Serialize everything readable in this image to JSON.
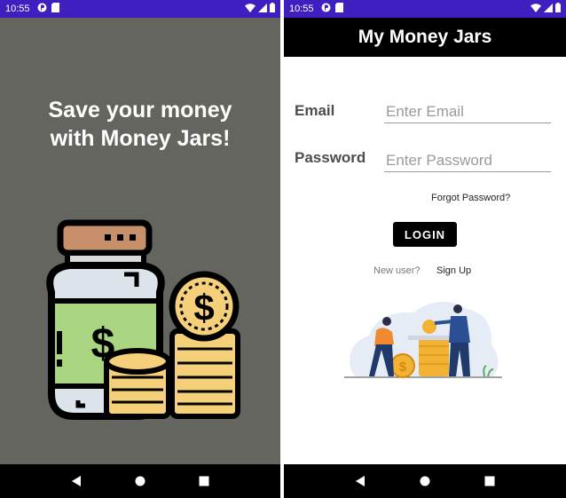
{
  "left_screen": {
    "status": {
      "time": "10:55"
    },
    "title_line1": "Save your money",
    "title_line2": "with Money Jars!",
    "illustration": "money-jar-and-coins",
    "nav": [
      "back",
      "home",
      "recents"
    ]
  },
  "right_screen": {
    "status": {
      "time": "10:55"
    },
    "header_title": "My Money Jars",
    "email_label": "Email",
    "email_placeholder": "Enter Email",
    "password_label": "Password",
    "password_placeholder": "Enter Password",
    "forgot_password": "Forgot Password?",
    "login_button": "LOGIN",
    "new_user_text": "New user?",
    "sign_up_link": "Sign Up",
    "illustration": "people-saving-coins",
    "nav": [
      "back",
      "home",
      "recents"
    ]
  },
  "colors": {
    "status_bar": "#3f1fc0",
    "splash_background": "#65655f",
    "header_background": "#000000",
    "nav_bar": "#000000"
  }
}
